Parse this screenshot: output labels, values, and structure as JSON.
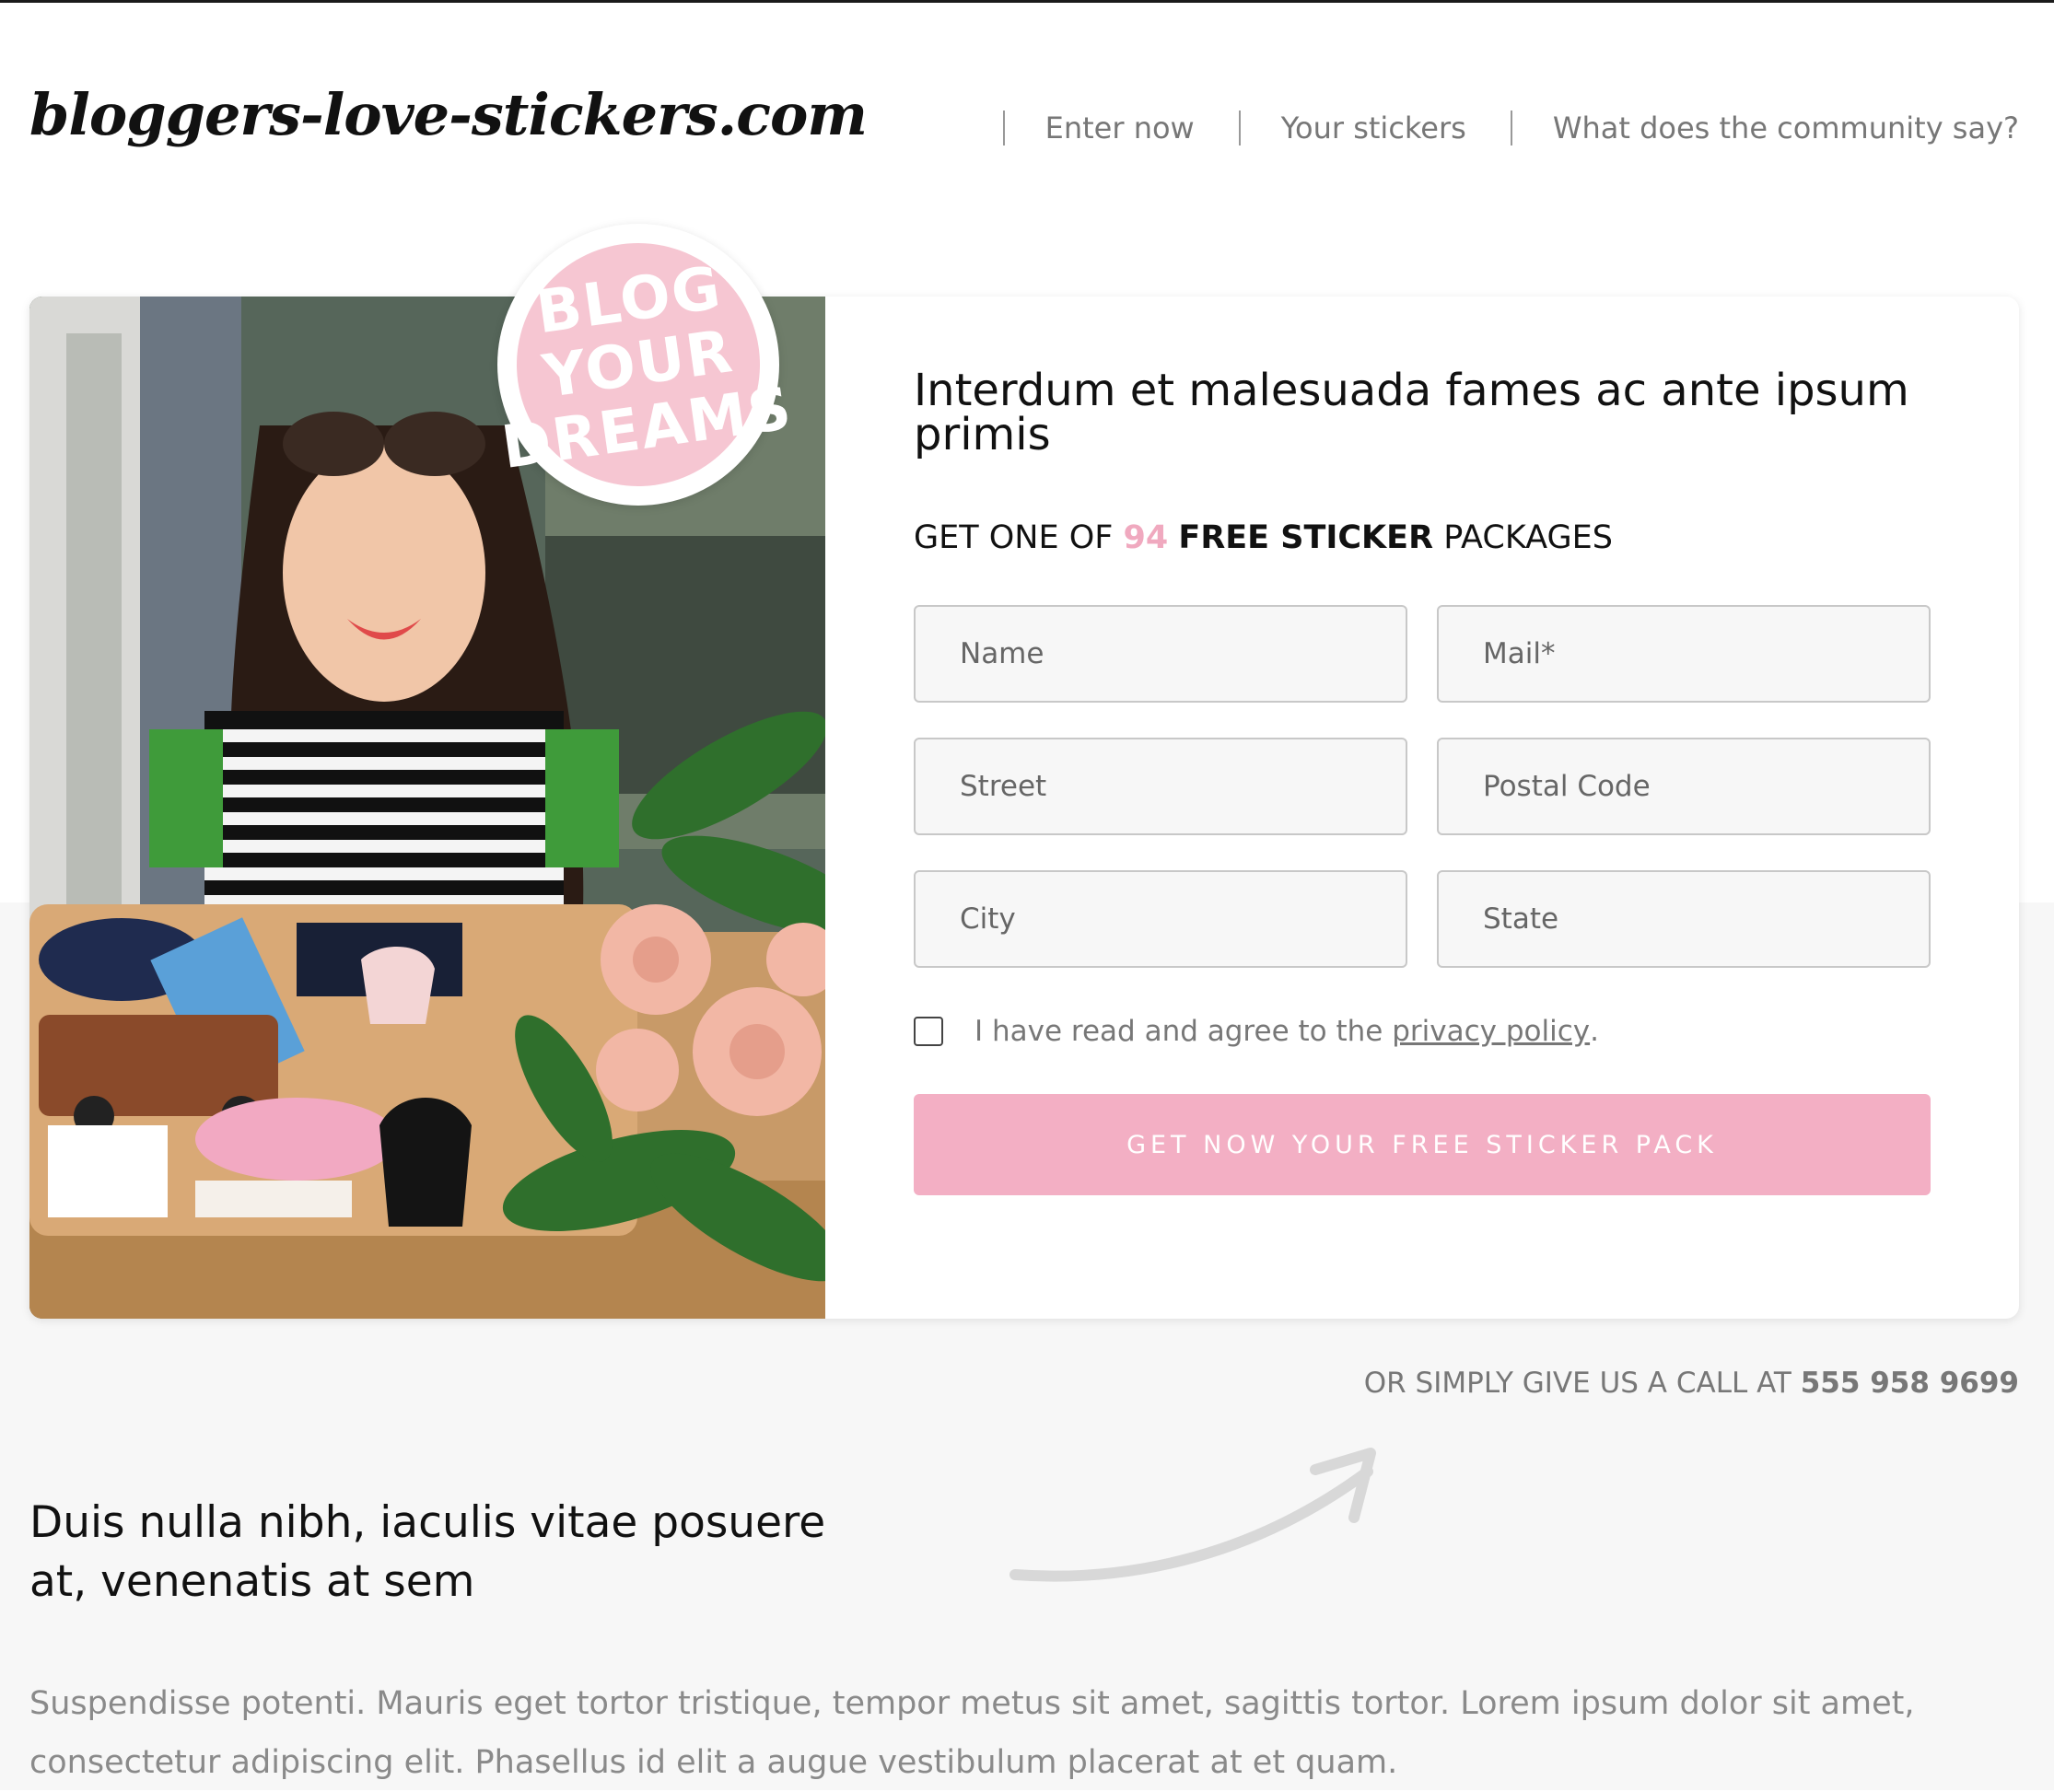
{
  "header": {
    "logo": "bloggers-love-stickers.com",
    "nav": [
      {
        "label": "Enter now"
      },
      {
        "label": "Your stickers"
      },
      {
        "label": "What does the community say?"
      }
    ]
  },
  "badge": {
    "lines": [
      "BLOG",
      "YOUR",
      "DREAMS"
    ]
  },
  "form": {
    "heading": "Interdum et malesuada fames ac ante ipsum primis",
    "packages": {
      "prefix": "GET ONE OF",
      "count": "94",
      "bold": "FREE STICKER",
      "suffix": "PACKAGES"
    },
    "fields": {
      "name": "Name",
      "mail": "Mail*",
      "street": "Street",
      "postal": "Postal Code",
      "city": "City",
      "state": "State"
    },
    "agree": {
      "prefix": "I have read and agree to the",
      "link": "privacy policy",
      "suffix": "."
    },
    "submit": "GET NOW YOUR FREE STICKER PACK"
  },
  "call": {
    "prefix": "OR SIMPLY GIVE US A CALL AT",
    "phone": "555 958 9699"
  },
  "section": {
    "heading": "Duis nulla nibh, iaculis vitae posuere at, venenatis at sem",
    "body": "Suspendisse potenti. Mauris eget tortor tristique, tempor metus sit amet, sagittis tortor. Lorem ipsum dolor sit amet, consectetur adipiscing elit. Phasellus id elit a augue vestibulum placerat at et quam."
  },
  "colors": {
    "accent_pink": "#f3afc4",
    "count_pink": "#f0a9bf",
    "page_gray": "#f7f7f7"
  },
  "image": {
    "photo": "woman-laptop-stickers-photo",
    "arrow": "hand-drawn-arrow-icon"
  }
}
